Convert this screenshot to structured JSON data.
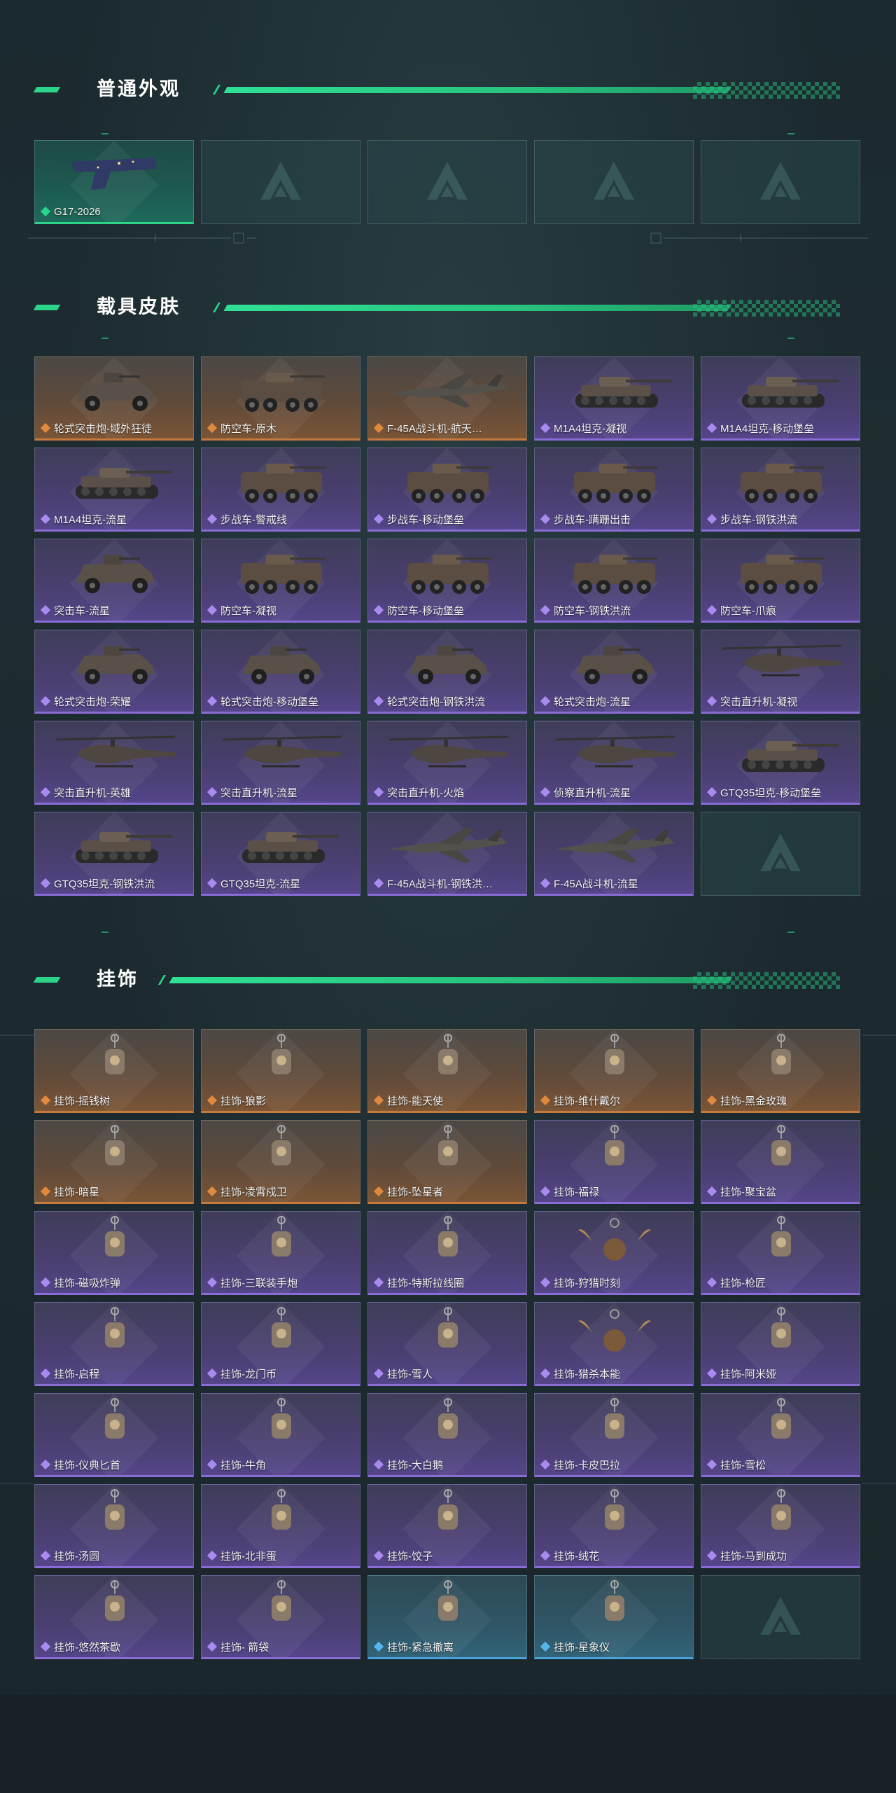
{
  "colors": {
    "accent": "#2ad58a",
    "orange": "#c77a3e",
    "purple": "#8a6cd6",
    "blue": "#4aa3d6",
    "green": "#2ad58a"
  },
  "sections": [
    {
      "title": "普通外观",
      "items": [
        {
          "label": "G17-2026",
          "rarity": "green",
          "icon": "pistol"
        },
        {
          "label": "",
          "rarity": "empty",
          "icon": "empty-slot"
        },
        {
          "label": "",
          "rarity": "empty",
          "icon": "empty-slot"
        },
        {
          "label": "",
          "rarity": "empty",
          "icon": "empty-slot"
        },
        {
          "label": "",
          "rarity": "empty",
          "icon": "empty-slot"
        }
      ]
    },
    {
      "title": "载具皮肤",
      "items": [
        {
          "label": "轮式突击炮-域外狂徒",
          "rarity": "orange",
          "icon": "armored-car"
        },
        {
          "label": "防空车-原木",
          "rarity": "orange",
          "icon": "apc"
        },
        {
          "label": "F-45A战斗机-航天…",
          "rarity": "orange",
          "icon": "jet"
        },
        {
          "label": "M1A4坦克-凝视",
          "rarity": "purple",
          "icon": "tank"
        },
        {
          "label": "M1A4坦克-移动堡垒",
          "rarity": "purple",
          "icon": "tank"
        },
        {
          "label": "M1A4坦克-流星",
          "rarity": "purple",
          "icon": "tank"
        },
        {
          "label": "步战车-警戒线",
          "rarity": "purple",
          "icon": "apc"
        },
        {
          "label": "步战车-移动堡垒",
          "rarity": "purple",
          "icon": "apc"
        },
        {
          "label": "步战车-蹒跚出击",
          "rarity": "purple",
          "icon": "apc"
        },
        {
          "label": "步战车-钢铁洪流",
          "rarity": "purple",
          "icon": "apc"
        },
        {
          "label": "突击车-流星",
          "rarity": "purple",
          "icon": "armored-car"
        },
        {
          "label": "防空车-凝视",
          "rarity": "purple",
          "icon": "apc"
        },
        {
          "label": "防空车-移动堡垒",
          "rarity": "purple",
          "icon": "apc"
        },
        {
          "label": "防空车-钢铁洪流",
          "rarity": "purple",
          "icon": "apc"
        },
        {
          "label": "防空车-爪痕",
          "rarity": "purple",
          "icon": "apc"
        },
        {
          "label": "轮式突击炮-荣耀",
          "rarity": "purple",
          "icon": "armored-car"
        },
        {
          "label": "轮式突击炮-移动堡垒",
          "rarity": "purple",
          "icon": "armored-car"
        },
        {
          "label": "轮式突击炮-钢铁洪流",
          "rarity": "purple",
          "icon": "armored-car"
        },
        {
          "label": "轮式突击炮-流星",
          "rarity": "purple",
          "icon": "armored-car"
        },
        {
          "label": "突击直升机-凝视",
          "rarity": "purple",
          "icon": "helicopter"
        },
        {
          "label": "突击直升机-英雄",
          "rarity": "purple",
          "icon": "helicopter"
        },
        {
          "label": "突击直升机-流星",
          "rarity": "purple",
          "icon": "helicopter"
        },
        {
          "label": "突击直升机-火焰",
          "rarity": "purple",
          "icon": "helicopter"
        },
        {
          "label": "侦察直升机-流星",
          "rarity": "purple",
          "icon": "helicopter"
        },
        {
          "label": "GTQ35坦克-移动堡垒",
          "rarity": "purple",
          "icon": "tank"
        },
        {
          "label": "GTQ35坦克-钢铁洪流",
          "rarity": "purple",
          "icon": "tank"
        },
        {
          "label": "GTQ35坦克-流星",
          "rarity": "purple",
          "icon": "tank"
        },
        {
          "label": "F-45A战斗机-钢铁洪…",
          "rarity": "purple",
          "icon": "jet"
        },
        {
          "label": "F-45A战斗机-流星",
          "rarity": "purple",
          "icon": "jet"
        },
        {
          "label": "",
          "rarity": "empty",
          "icon": "empty-slot"
        }
      ]
    },
    {
      "title": "挂饰",
      "items": [
        {
          "label": "挂饰-摇钱树",
          "rarity": "orange",
          "icon": "charm"
        },
        {
          "label": "挂饰-狼影",
          "rarity": "orange",
          "icon": "charm"
        },
        {
          "label": "挂饰-能天使",
          "rarity": "orange",
          "icon": "charm"
        },
        {
          "label": "挂饰-维什戴尔",
          "rarity": "orange",
          "icon": "charm"
        },
        {
          "label": "挂饰-黑金玫瑰",
          "rarity": "orange",
          "icon": "charm"
        },
        {
          "label": "挂饰-暗星",
          "rarity": "orange",
          "icon": "charm"
        },
        {
          "label": "挂饰-凌霄戍卫",
          "rarity": "orange",
          "icon": "charm"
        },
        {
          "label": "挂饰-坠星者",
          "rarity": "orange",
          "icon": "charm"
        },
        {
          "label": "挂饰-福禄",
          "rarity": "purple",
          "icon": "charm"
        },
        {
          "label": "挂饰-聚宝盆",
          "rarity": "purple",
          "icon": "charm"
        },
        {
          "label": "挂饰-磁吸炸弹",
          "rarity": "purple",
          "icon": "charm"
        },
        {
          "label": "挂饰-三联装手炮",
          "rarity": "purple",
          "icon": "charm"
        },
        {
          "label": "挂饰-特斯拉线圈",
          "rarity": "purple",
          "icon": "charm"
        },
        {
          "label": "挂饰-狩猎时刻",
          "rarity": "purple",
          "icon": "antler-charm"
        },
        {
          "label": "挂饰-枪匠",
          "rarity": "purple",
          "icon": "charm"
        },
        {
          "label": "挂饰-启程",
          "rarity": "purple",
          "icon": "charm"
        },
        {
          "label": "挂饰-龙门币",
          "rarity": "purple",
          "icon": "charm"
        },
        {
          "label": "挂饰-雪人",
          "rarity": "purple",
          "icon": "charm"
        },
        {
          "label": "挂饰-猎杀本能",
          "rarity": "purple",
          "icon": "antler-charm"
        },
        {
          "label": "挂饰-阿米娅",
          "rarity": "purple",
          "icon": "charm"
        },
        {
          "label": "挂饰-仪典匕首",
          "rarity": "purple",
          "icon": "charm"
        },
        {
          "label": "挂饰-牛角",
          "rarity": "purple",
          "icon": "charm"
        },
        {
          "label": "挂饰-大白鹅",
          "rarity": "purple",
          "icon": "charm"
        },
        {
          "label": "挂饰-卡皮巴拉",
          "rarity": "purple",
          "icon": "charm"
        },
        {
          "label": "挂饰-雪松",
          "rarity": "purple",
          "icon": "charm"
        },
        {
          "label": "挂饰-汤圆",
          "rarity": "purple",
          "icon": "charm"
        },
        {
          "label": "挂饰-北非蛋",
          "rarity": "purple",
          "icon": "charm"
        },
        {
          "label": "挂饰-饺子",
          "rarity": "purple",
          "icon": "charm"
        },
        {
          "label": "挂饰-绒花",
          "rarity": "purple",
          "icon": "charm"
        },
        {
          "label": "挂饰-马到成功",
          "rarity": "purple",
          "icon": "charm"
        },
        {
          "label": "挂饰-悠然茶歇",
          "rarity": "purple",
          "icon": "charm"
        },
        {
          "label": "挂饰- 箭袋",
          "rarity": "purple",
          "icon": "charm"
        },
        {
          "label": "挂饰-紧急撤离",
          "rarity": "blue",
          "icon": "charm"
        },
        {
          "label": "挂饰-星象仪",
          "rarity": "blue",
          "icon": "charm"
        },
        {
          "label": "",
          "rarity": "empty",
          "icon": "empty-slot"
        }
      ]
    }
  ]
}
